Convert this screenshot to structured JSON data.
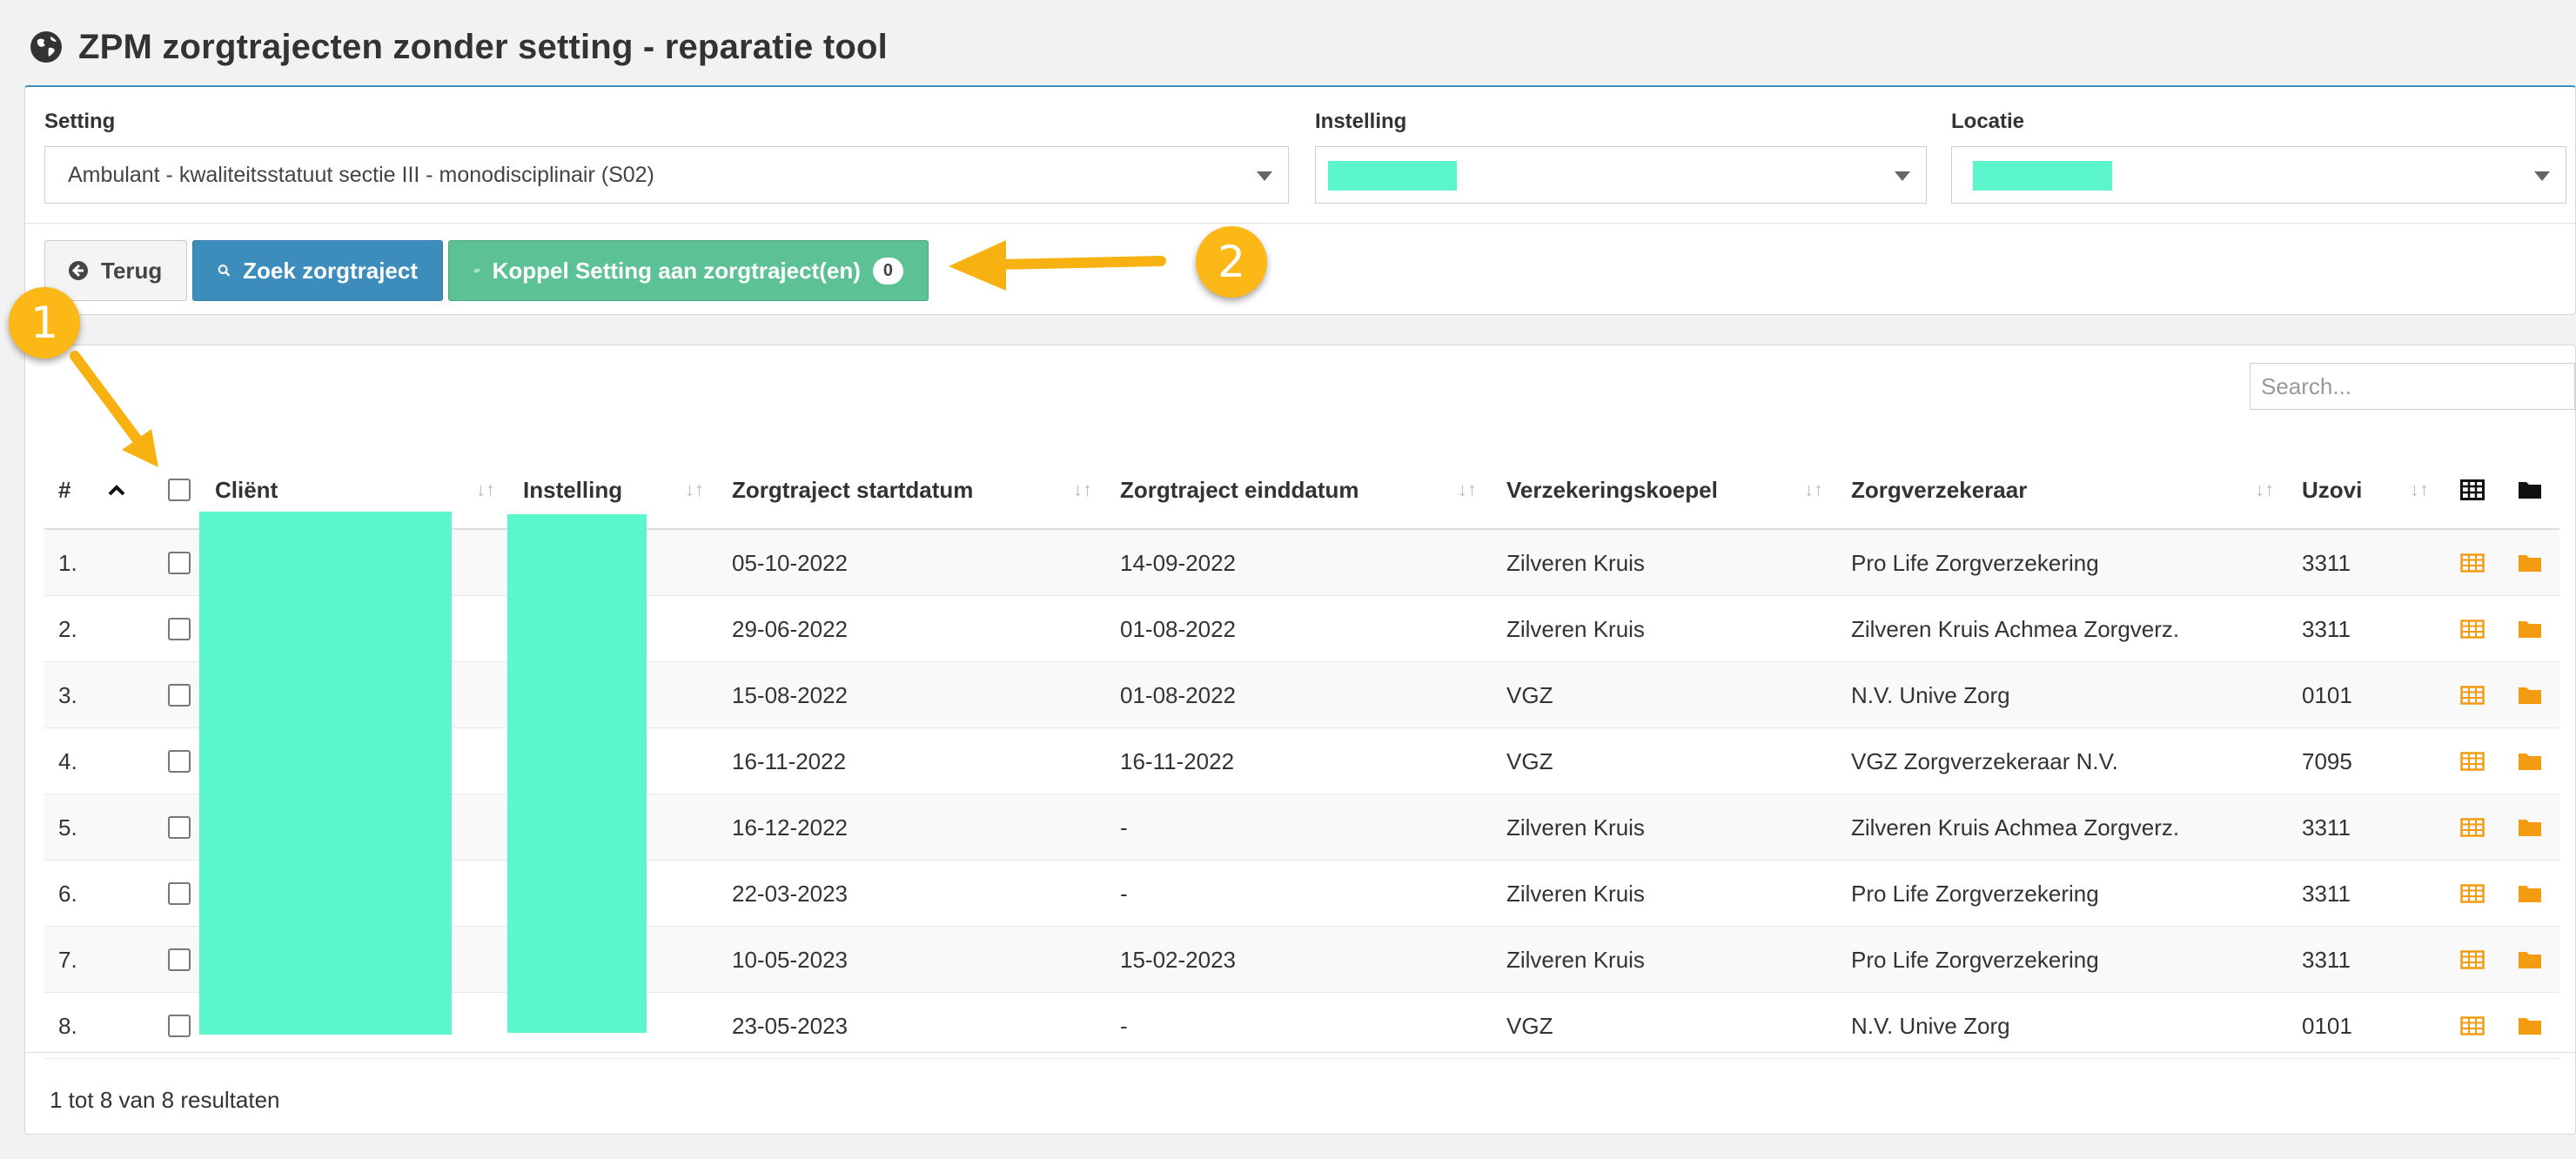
{
  "page": {
    "title": "ZPM zorgtrajecten zonder setting - reparatie tool"
  },
  "filters": {
    "setting": {
      "label": "Setting",
      "value": "Ambulant - kwaliteitsstatuut sectie III - monodisciplinair (S02)"
    },
    "instelling": {
      "label": "Instelling",
      "value": ""
    },
    "locatie": {
      "label": "Locatie",
      "value": ""
    }
  },
  "toolbar": {
    "back_label": "Terug",
    "search_label": "Zoek zorgtraject",
    "link_label": "Koppel Setting aan zorgtraject(en)",
    "link_count": "0"
  },
  "search": {
    "placeholder": "Search..."
  },
  "table": {
    "columns": {
      "num": "#",
      "client": "Cliënt",
      "instelling": "Instelling",
      "start": "Zorgtraject startdatum",
      "end": "Zorgtraject einddatum",
      "koepel": "Verzekeringskoepel",
      "verzekeraar": "Zorgverzekeraar",
      "uzovi": "Uzovi"
    },
    "rows": [
      {
        "num": "1.",
        "start": "05-10-2022",
        "end": "14-09-2022",
        "koepel": "Zilveren Kruis",
        "verzekeraar": "Pro Life Zorgverzekering",
        "uzovi": "3311"
      },
      {
        "num": "2.",
        "start": "29-06-2022",
        "end": "01-08-2022",
        "koepel": "Zilveren Kruis",
        "verzekeraar": "Zilveren Kruis Achmea Zorgverz.",
        "uzovi": "3311"
      },
      {
        "num": "3.",
        "start": "15-08-2022",
        "end": "01-08-2022",
        "koepel": "VGZ",
        "verzekeraar": "N.V. Unive Zorg",
        "uzovi": "0101"
      },
      {
        "num": "4.",
        "start": "16-11-2022",
        "end": "16-11-2022",
        "koepel": "VGZ",
        "verzekeraar": "VGZ Zorgverzekeraar N.V.",
        "uzovi": "7095"
      },
      {
        "num": "5.",
        "start": "16-12-2022",
        "end": "-",
        "koepel": "Zilveren Kruis",
        "verzekeraar": "Zilveren Kruis Achmea Zorgverz.",
        "uzovi": "3311"
      },
      {
        "num": "6.",
        "start": "22-03-2023",
        "end": "-",
        "koepel": "Zilveren Kruis",
        "verzekeraar": "Pro Life Zorgverzekering",
        "uzovi": "3311"
      },
      {
        "num": "7.",
        "start": "10-05-2023",
        "end": "15-02-2023",
        "koepel": "Zilveren Kruis",
        "verzekeraar": "Pro Life Zorgverzekering",
        "uzovi": "3311"
      },
      {
        "num": "8.",
        "start": "23-05-2023",
        "end": "-",
        "koepel": "VGZ",
        "verzekeraar": "N.V. Unive Zorg",
        "uzovi": "0101"
      }
    ],
    "footer": "1 tot 8 van 8 resultaten"
  },
  "annotations": {
    "marker1": "1",
    "marker2": "2"
  },
  "colors": {
    "primary": "#3c8dbc",
    "success": "#5cc295",
    "redaction": "#5cf6cc",
    "icon_orange": "#f39c12",
    "marker": "#fbb817"
  }
}
